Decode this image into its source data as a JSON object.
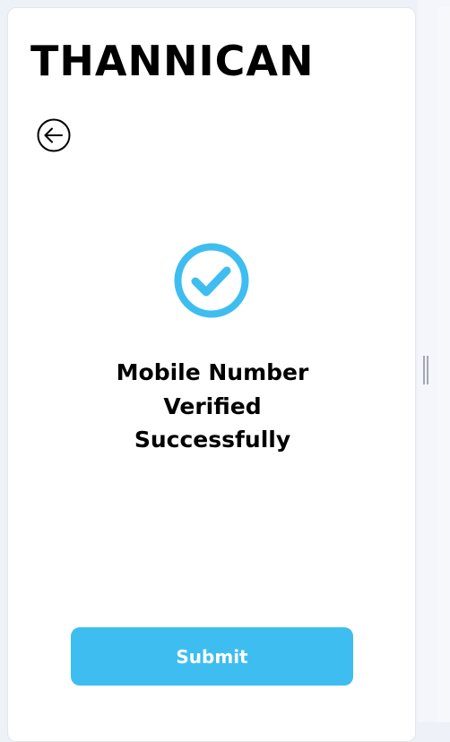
{
  "app": {
    "title": "THANNICAN"
  },
  "icons": {
    "back": "arrow-left-circle-icon",
    "success": "check-circle-icon"
  },
  "verification": {
    "message_line1": "Mobile Number",
    "message_line2": "Verified",
    "message_line3": "Successfully"
  },
  "actions": {
    "submit_label": "Submit"
  },
  "colors": {
    "accent": "#3ebdf0",
    "text": "#000000",
    "card_background": "#ffffff",
    "page_background": "#eef1f8"
  }
}
